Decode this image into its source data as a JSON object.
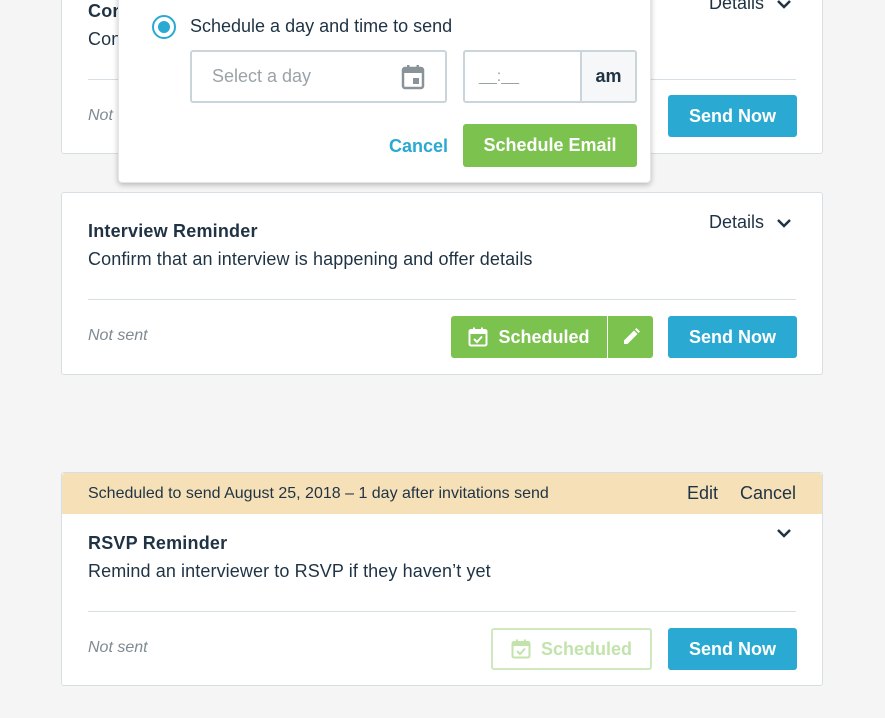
{
  "card1": {
    "title_partial": "Con",
    "desc_partial": "Con",
    "status_partial": "Not ",
    "details_label": "Details",
    "send_now_label": "Send Now"
  },
  "popover": {
    "radio_label": "Schedule a day and time to send",
    "day_placeholder": "Select a day",
    "time_placeholder": "__:__",
    "ampm": "am",
    "cancel_label": "Cancel",
    "schedule_label": "Schedule Email"
  },
  "card2": {
    "title": "Interview Reminder",
    "desc": "Confirm that an interview is happening and offer details",
    "details_label": "Details",
    "status": "Not sent",
    "scheduled_label": "Scheduled",
    "send_now_label": "Send Now"
  },
  "card3": {
    "banner_text": "Scheduled to send August 25, 2018 – 1 day after invitations send",
    "banner_edit": "Edit",
    "banner_cancel": "Cancel",
    "title": "RSVP Reminder",
    "desc": "Remind an interviewer to RSVP if they haven’t yet",
    "status": "Not sent",
    "scheduled_label": "Scheduled",
    "send_now_label": "Send Now"
  },
  "colors": {
    "accent_blue": "#2aa9d2",
    "accent_green": "#7cc24f",
    "banner": "#f5e0b8"
  },
  "icons": [
    "calendar-icon",
    "calendar-check-icon",
    "pencil-icon",
    "chevron-down-icon"
  ]
}
